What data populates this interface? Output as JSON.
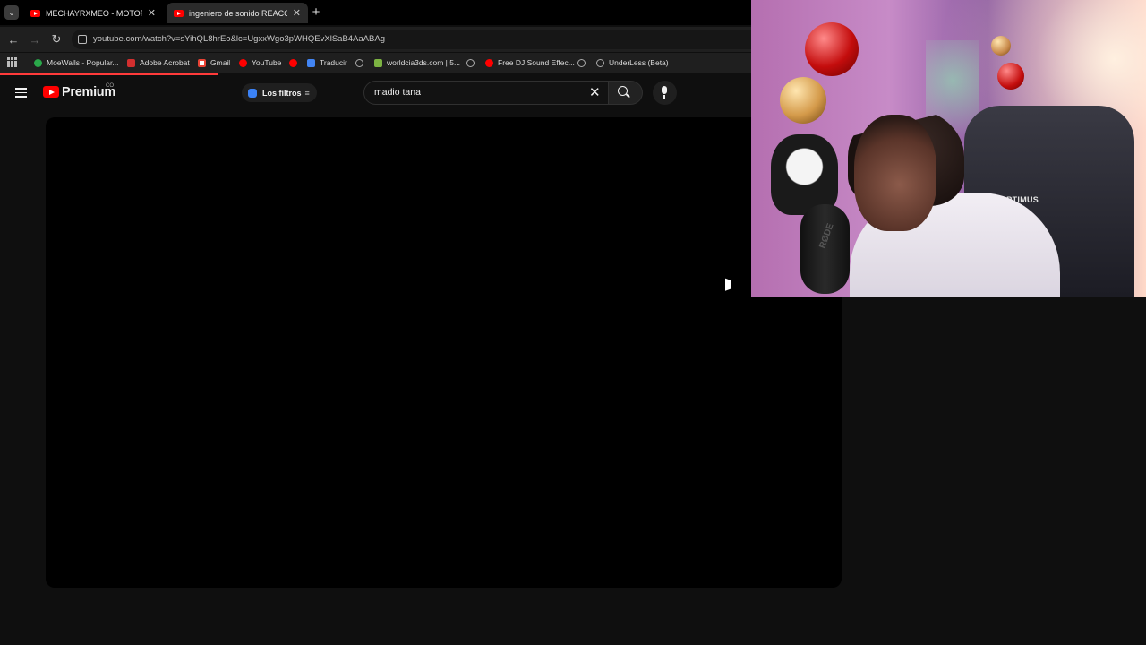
{
  "browser": {
    "tabs": [
      {
        "title": "MECHAYRXMEO - MOTORSPOR",
        "active": false
      },
      {
        "title": "ingeniero de sonido REACCION",
        "active": true
      }
    ],
    "url": "youtube.com/watch?v=sYihQL8hrEo&lc=UgxxWgo3pWHQEvXlSaB4AaABAg",
    "bookmarks": [
      {
        "label": "MoeWalls - Popular...",
        "icon": "g"
      },
      {
        "label": "Adobe Acrobat",
        "icon": "a"
      },
      {
        "label": "Gmail",
        "icon": "m"
      },
      {
        "label": "YouTube",
        "icon": "y"
      },
      {
        "label": "",
        "icon": "y"
      },
      {
        "label": "Traducir",
        "icon": "t"
      },
      {
        "label": "",
        "icon": "w"
      },
      {
        "label": "worldcia3ds.com | 5...",
        "icon": "p"
      },
      {
        "label": "",
        "icon": "w"
      },
      {
        "label": "Free DJ Sound Effec...",
        "icon": "y"
      },
      {
        "label": "",
        "icon": "w"
      },
      {
        "label": "UnderLess (Beta)",
        "icon": "w"
      }
    ]
  },
  "youtube": {
    "logo_text": "Premium",
    "country_code": "CO",
    "filters_label": "Los filtros",
    "search_value": "madio tana",
    "colors": {
      "brand": "#ff0000",
      "background": "#0f0f0f"
    }
  },
  "webcam": {
    "chair_logo": "OPTIMUS",
    "mic_brand": "RØDE"
  }
}
